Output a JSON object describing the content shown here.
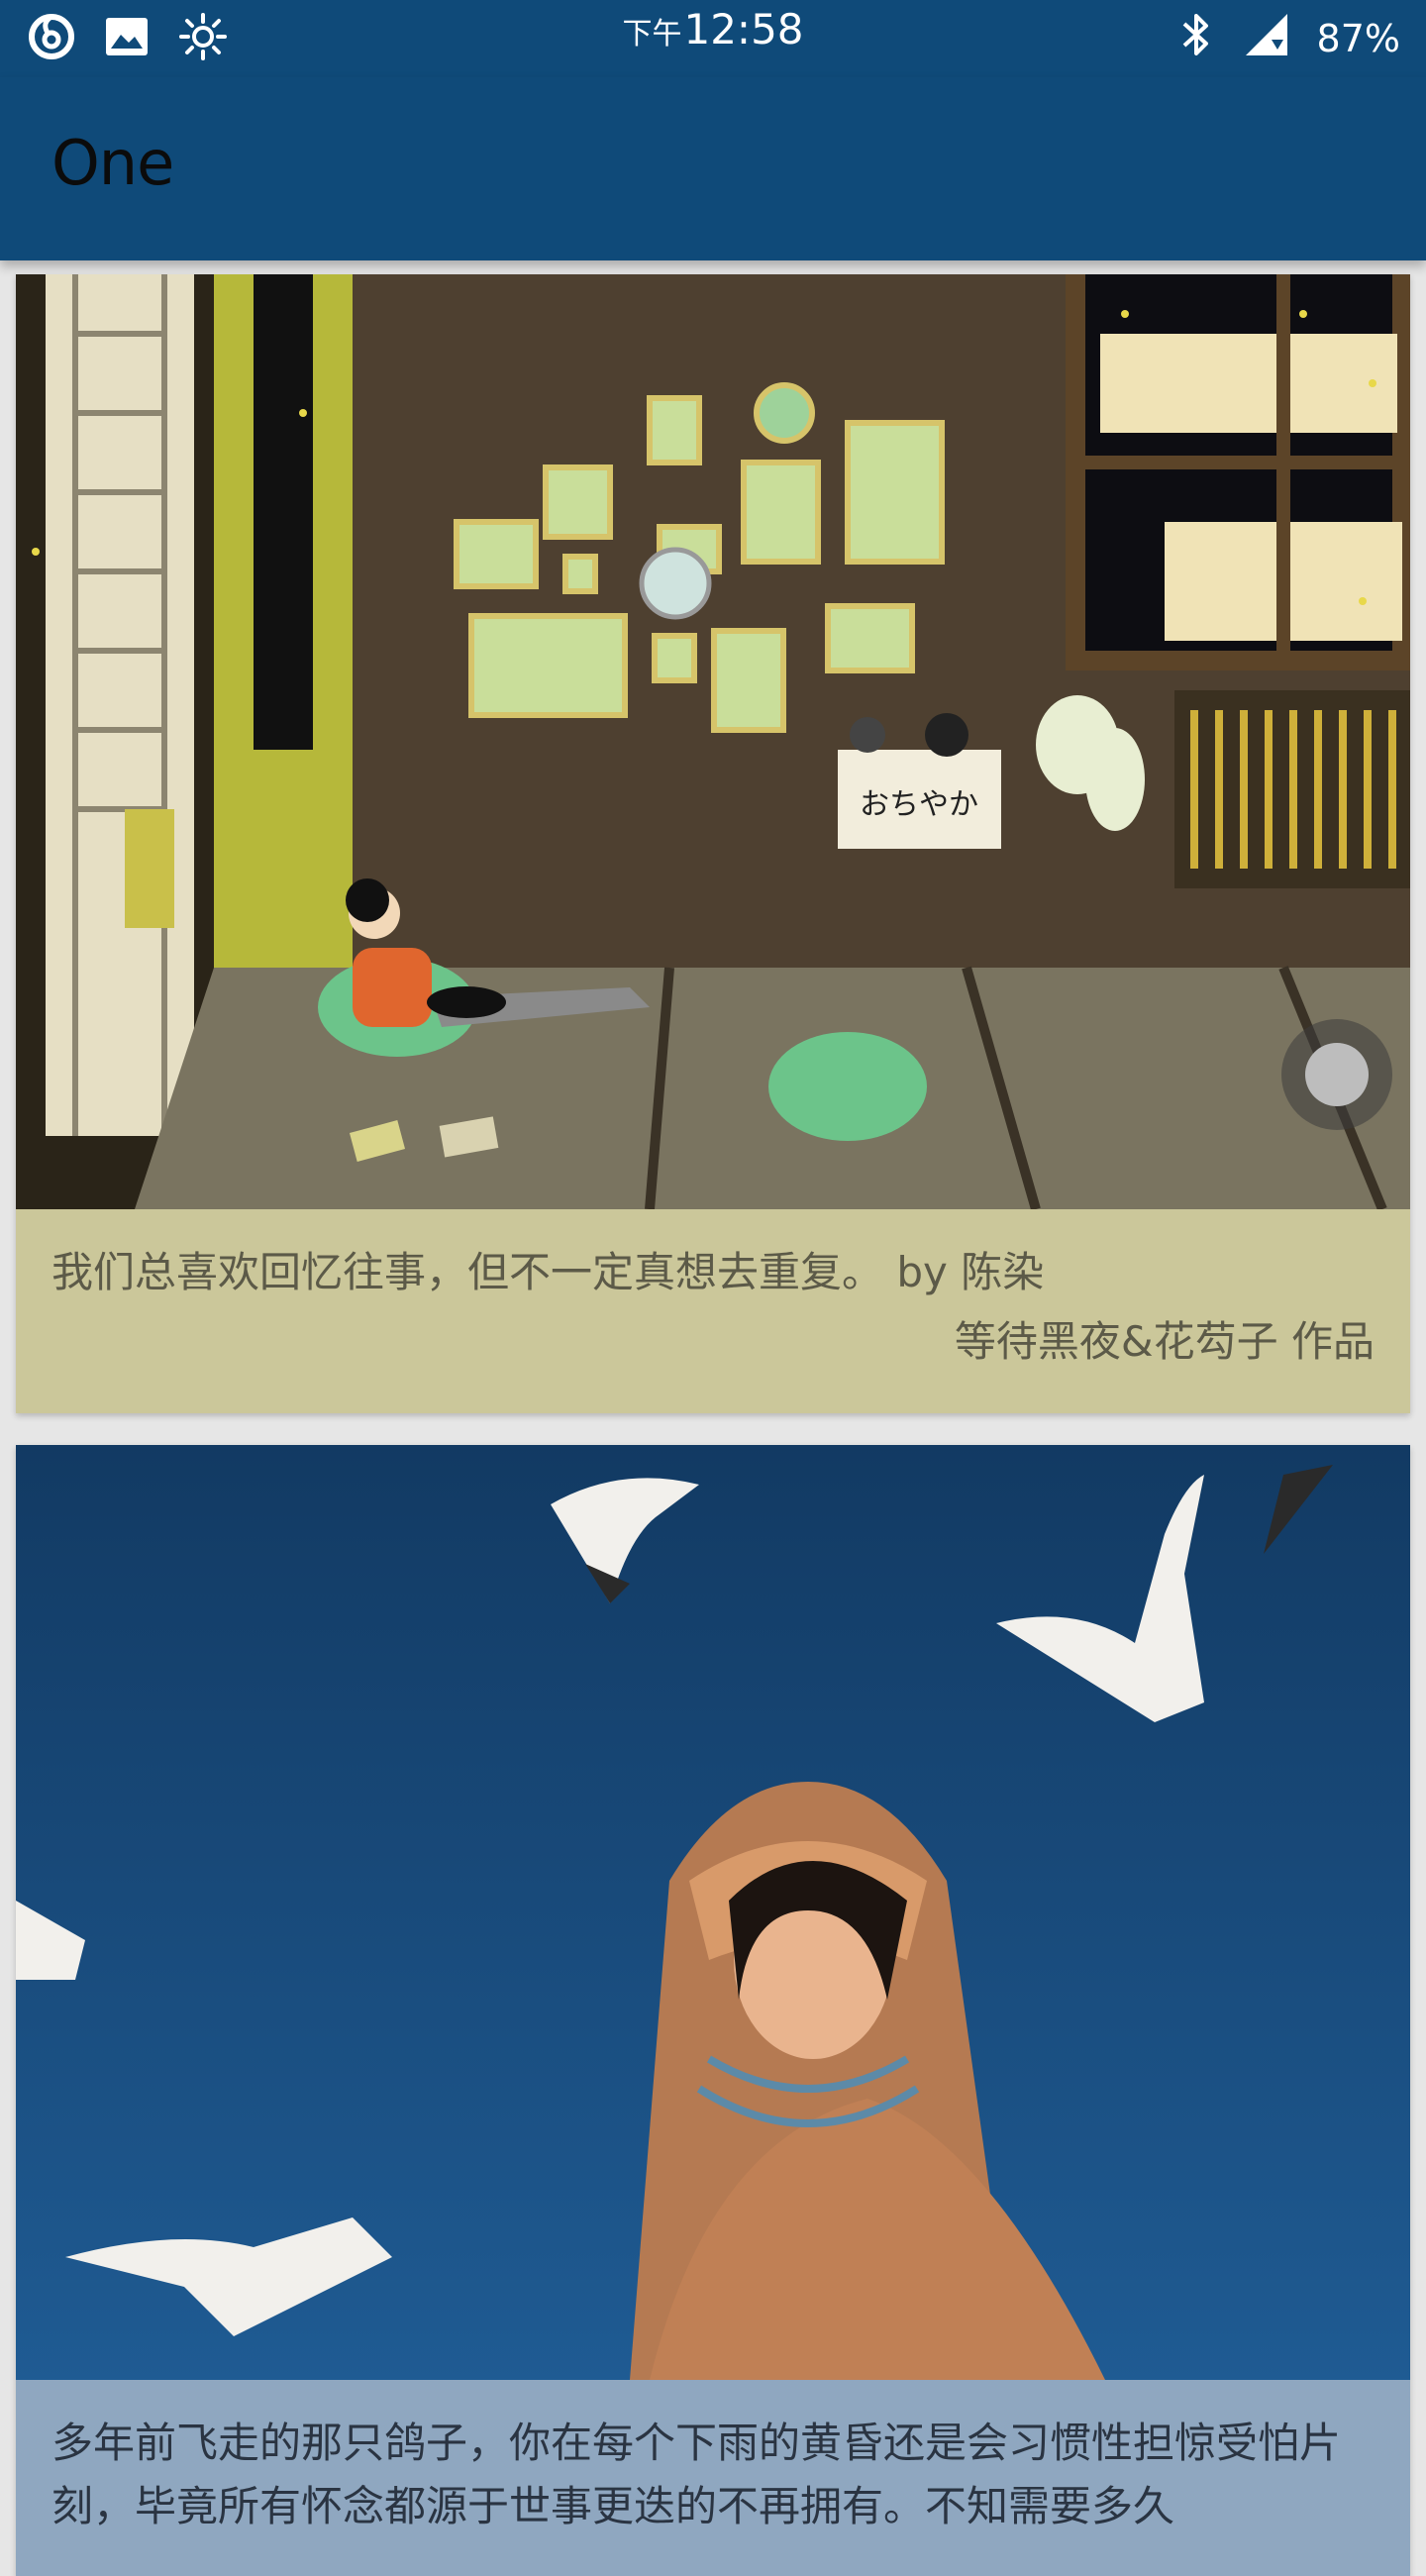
{
  "status_bar": {
    "ampm": "下午",
    "time": "12:58",
    "battery": "87%",
    "icons_left": [
      "netease-music-icon",
      "image-icon",
      "brightness-icon"
    ],
    "icons_right": [
      "bluetooth-icon",
      "signal-icon"
    ]
  },
  "app_bar": {
    "title": "One"
  },
  "cards": [
    {
      "caption": "我们总喜欢回忆往事，但不一定真想去重复。 by 陈染",
      "credit": "等待黑夜&花芶子 作品",
      "image": "illustration-room-night"
    },
    {
      "caption": "多年前飞走的那只鸽子，你在每个下雨的黄昏还是会习惯性担惊受怕片刻，毕竟所有怀念都源于世事更迭的不再拥有。不知需要多久",
      "image": "photo-girl-with-seagulls"
    }
  ],
  "colors": {
    "primary": "#0f4a79",
    "card1_text_bg": "#cbc79a",
    "card2_text_bg": "#8fa7c0"
  }
}
